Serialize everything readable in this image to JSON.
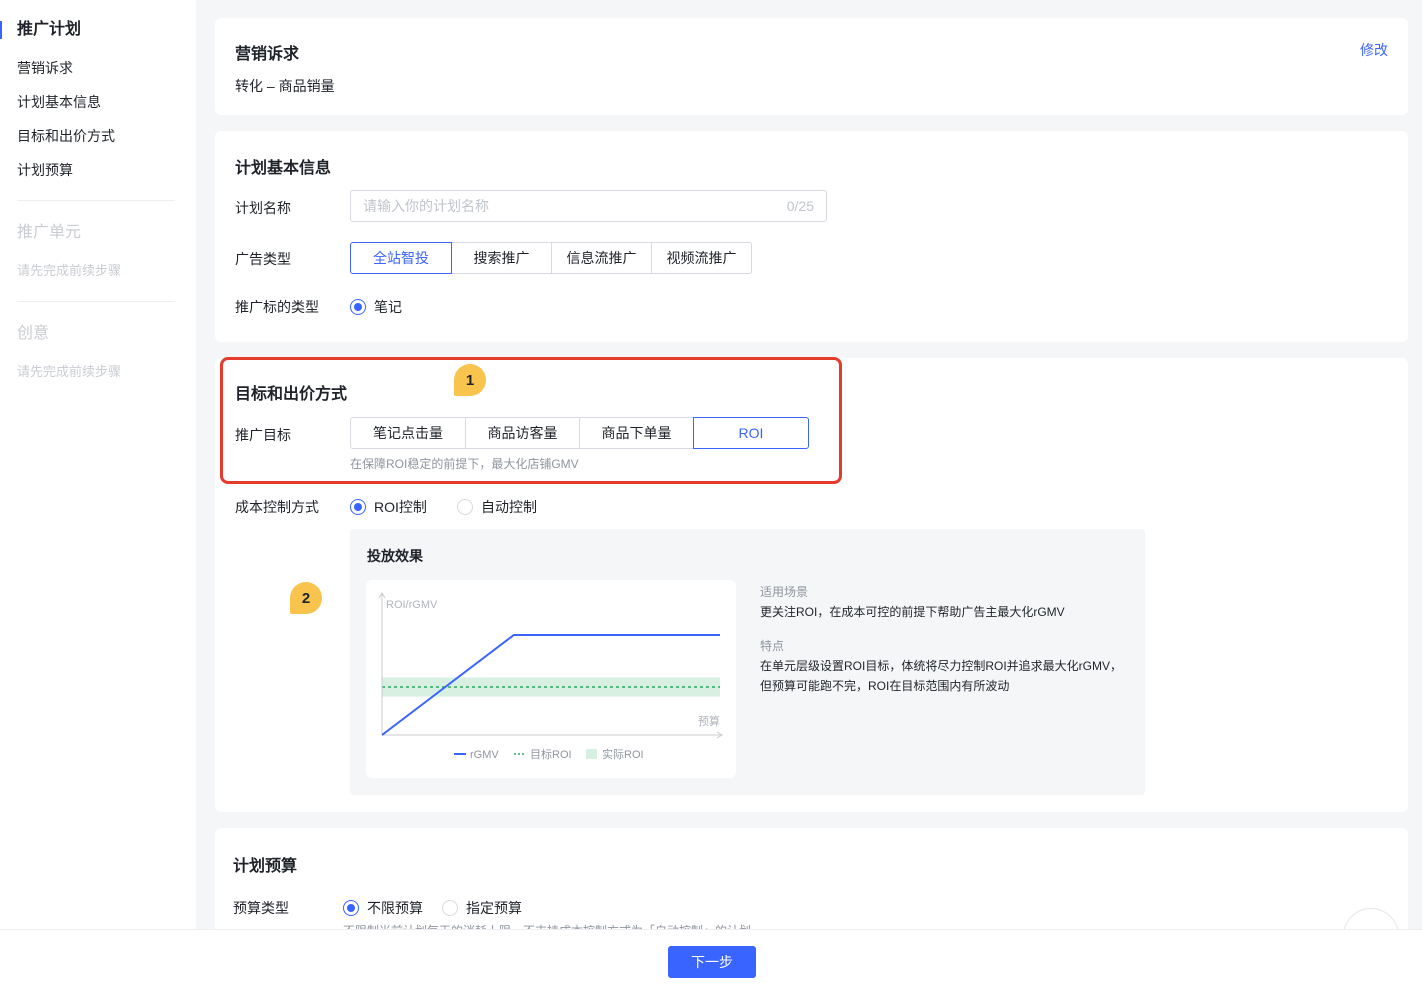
{
  "sidebar": {
    "plan_title": "推广计划",
    "plan_items": [
      "营销诉求",
      "计划基本信息",
      "目标和出价方式",
      "计划预算"
    ],
    "unit_title": "推广单元",
    "unit_hint": "请先完成前续步骤",
    "creative_title": "创意",
    "creative_hint": "请先完成前续步骤"
  },
  "marketing": {
    "title": "营销诉求",
    "value": "转化 – 商品销量",
    "edit_label": "修改"
  },
  "basic": {
    "title": "计划基本信息",
    "name_label": "计划名称",
    "name_placeholder": "请输入你的计划名称",
    "name_counter": "0/25",
    "ad_type_label": "广告类型",
    "ad_types": [
      "全站智投",
      "搜索推广",
      "信息流推广",
      "视频流推广"
    ],
    "ad_type_selected": "全站智投",
    "target_type_label": "推广标的类型",
    "target_type_option": "笔记"
  },
  "goal": {
    "title": "目标和出价方式",
    "target_label": "推广目标",
    "targets": [
      "笔记点击量",
      "商品访客量",
      "商品下单量",
      "ROI"
    ],
    "target_selected": "ROI",
    "target_hint": "在保障ROI稳定的前提下，最大化店铺GMV",
    "cost_label": "成本控制方式",
    "cost_options": [
      "ROI控制",
      "自动控制"
    ],
    "cost_selected": "ROI控制",
    "effect_title": "投放效果",
    "scene_label": "适用场景",
    "scene_text": "更关注ROI，在成本可控的前提下帮助广告主最大化rGMV",
    "feature_label": "特点",
    "feature_text": "在单元层级设置ROI目标，体统将尽力控制ROI并追求最大化rGMV，但预算可能跑不完，ROI在目标范围内有所波动"
  },
  "annotations": {
    "badge1": "1",
    "badge2": "2"
  },
  "budget": {
    "title": "计划预算",
    "type_label": "预算类型",
    "options": [
      "不限预算",
      "指定预算"
    ],
    "selected": "不限预算",
    "cut_hint": "不限制当前计划每天的消耗上限，不支持成本控制方式为「自动控制」的计划"
  },
  "footer": {
    "next_label": "下一步"
  },
  "colors": {
    "accent": "#3a64ff",
    "highlight": "#e53b2b",
    "badge": "#f8c44d",
    "target_band": "#d7f0e2",
    "target_line": "#2ea860"
  },
  "chart_data": {
    "type": "line",
    "title": "",
    "ylabel": "ROI/rGMV",
    "xlabel": "预算",
    "series": [
      {
        "name": "rGMV",
        "kind": "line",
        "x": [
          0,
          0.39,
          1.0
        ],
        "y": [
          0,
          0.73,
          0.73
        ]
      },
      {
        "name": "目标ROI",
        "kind": "dashed-line",
        "y": 0.35
      },
      {
        "name": "实际ROI",
        "kind": "band",
        "range": [
          0.28,
          0.42
        ]
      }
    ],
    "legend": [
      "rGMV",
      "目标ROI",
      "实际ROI"
    ],
    "legend_position": "bottom",
    "grid": false,
    "xlim": [
      0,
      1
    ],
    "ylim": [
      0,
      1
    ]
  }
}
